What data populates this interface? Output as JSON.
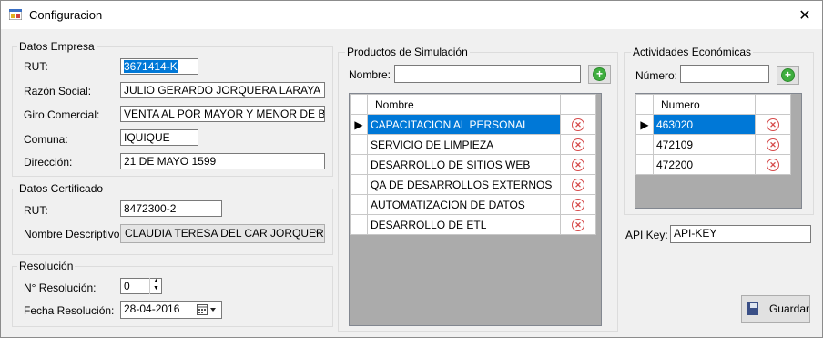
{
  "window": {
    "title": "Configuracion",
    "close": "✕"
  },
  "empresa": {
    "legend": "Datos Empresa",
    "rut_label": "RUT:",
    "rut": "3671414-K",
    "razon_label": "Razón Social:",
    "razon": "JULIO GERARDO JORQUERA LARAYA",
    "giro_label": "Giro Comercial:",
    "giro": "VENTA AL POR MAYOR Y MENOR DE BEBII",
    "comuna_label": "Comuna:",
    "comuna": "IQUIQUE",
    "direccion_label": "Dirección:",
    "direccion": "21 DE MAYO 1599"
  },
  "certificado": {
    "legend": "Datos Certificado",
    "rut_label": "RUT:",
    "rut": "8472300-2",
    "nombre_label": "Nombre Descriptivo:",
    "nombre": "CLAUDIA TERESA DEL CAR JORQUERA"
  },
  "resolucion": {
    "legend": "Resolución",
    "numero_label": "N° Resolución:",
    "numero": "0",
    "fecha_label": "Fecha Resolución:",
    "fecha": "28-04-2016"
  },
  "productos": {
    "legend": "Productos de Simulación",
    "nombre_label": "Nombre:",
    "nombre_value": "",
    "column": "Nombre",
    "rows": [
      "CAPACITACION AL PERSONAL",
      "SERVICIO DE LIMPIEZA",
      "DESARROLLO DE SITIOS WEB",
      "QA DE DESARROLLOS EXTERNOS",
      "AUTOMATIZACION DE DATOS",
      "DESARROLLO DE ETL"
    ]
  },
  "actividades": {
    "legend": "Actividades Económicas",
    "numero_label": "Número:",
    "numero_value": "",
    "column": "Numero",
    "rows": [
      "463020",
      "472109",
      "472200"
    ]
  },
  "api": {
    "label": "API Key:",
    "value": "API-KEY"
  },
  "guardar_label": "Guardar",
  "colors": {
    "selection": "#0078d7",
    "add": "#3fae3f",
    "delete": "#d64a4a"
  }
}
